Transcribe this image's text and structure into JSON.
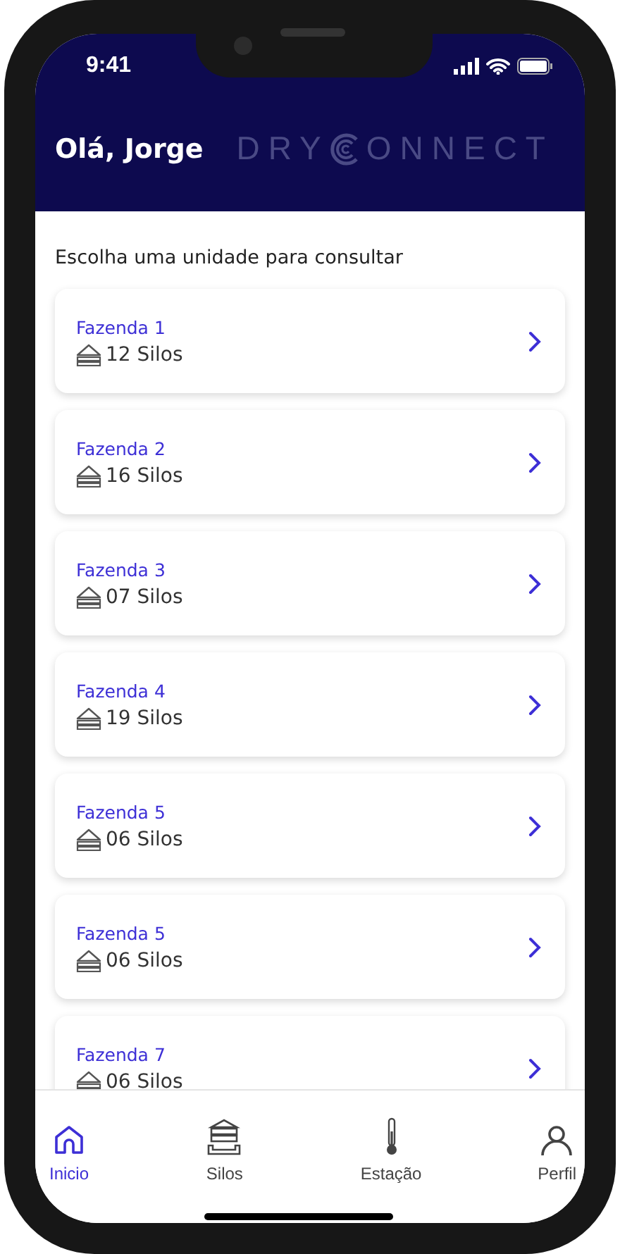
{
  "status_bar": {
    "time": "9:41"
  },
  "header": {
    "greeting": "Olá, Jorge",
    "logo_left": "DRY",
    "logo_right": "ONNECT"
  },
  "prompt": "Escolha uma unidade para consultar",
  "units": [
    {
      "name": "Fazenda 1",
      "silos": "12 Silos"
    },
    {
      "name": "Fazenda 2",
      "silos": "16 Silos"
    },
    {
      "name": "Fazenda 3",
      "silos": "07 Silos"
    },
    {
      "name": "Fazenda 4",
      "silos": "19 Silos"
    },
    {
      "name": "Fazenda 5",
      "silos": "06 Silos"
    },
    {
      "name": "Fazenda 5",
      "silos": "06 Silos"
    },
    {
      "name": "Fazenda 7",
      "silos": "06 Silos"
    }
  ],
  "tab_bar": [
    {
      "kind": "home",
      "label": "Inicio",
      "selected": true
    },
    {
      "kind": "silo",
      "label": "Silos",
      "selected": false
    },
    {
      "kind": "thermometer",
      "label": "Estação",
      "selected": false
    },
    {
      "kind": "person",
      "label": "Perfil",
      "selected": false
    }
  ]
}
